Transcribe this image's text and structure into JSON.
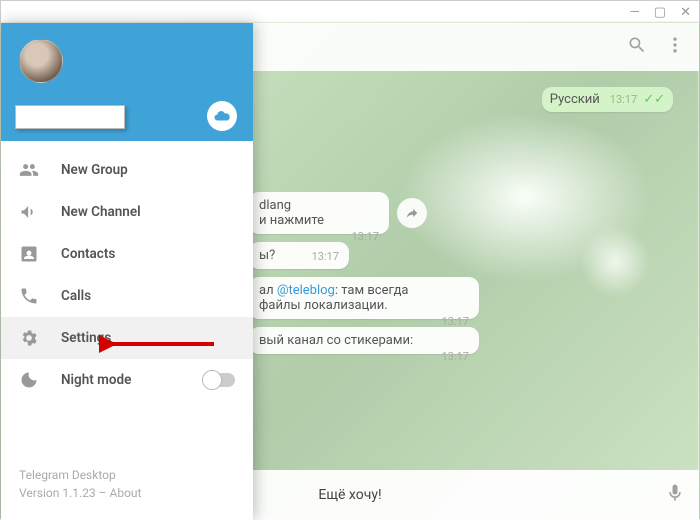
{
  "titlebar": {
    "minimize": "—",
    "maximize": "▢",
    "close": "✕"
  },
  "drawer": {
    "cloud_icon": "cloud",
    "menu": [
      {
        "key": "new-group",
        "label": "New Group"
      },
      {
        "key": "new-channel",
        "label": "New Channel"
      },
      {
        "key": "contacts",
        "label": "Contacts"
      },
      {
        "key": "calls",
        "label": "Calls"
      },
      {
        "key": "settings",
        "label": "Settings",
        "active": true
      },
      {
        "key": "night-mode",
        "label": "Night mode",
        "toggle": true
      }
    ],
    "footer": {
      "app_name": "Telegram Desktop",
      "version_line": "Version 1.1.23 – ",
      "about": "About"
    }
  },
  "chat": {
    "outgoing": {
      "text": "Русский",
      "time": "13:17"
    },
    "msg1": {
      "line1": "dlang",
      "line2": "и нажмите",
      "time": "13:17"
    },
    "msg2": {
      "text": "ы?",
      "time": "13:17"
    },
    "msg3": {
      "line1": "ал ",
      "mention": "@teleblog",
      "tail1": ": там всегда",
      "line2": "файлы локализации.",
      "time": "13:17"
    },
    "msg4": {
      "text": "вый канал со стикерами:",
      "time": "13:17"
    },
    "input": "Ещё хочу!"
  }
}
